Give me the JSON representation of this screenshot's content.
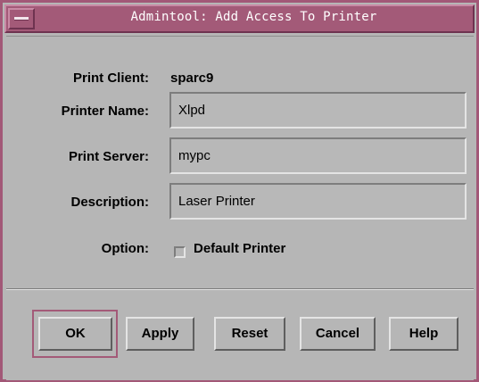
{
  "window": {
    "title": "Admintool: Add Access To Printer",
    "menu_icon": "window-menu-icon",
    "accent_color": "#a35a78",
    "background_color": "#b6b6b6"
  },
  "form": {
    "print_client": {
      "label": "Print Client:",
      "value": "sparc9"
    },
    "printer_name": {
      "label": "Printer Name:",
      "value": "Xlpd"
    },
    "print_server": {
      "label": "Print Server:",
      "value": "mypc"
    },
    "description": {
      "label": "Description:",
      "value": "Laser Printer"
    },
    "option": {
      "label": "Option:",
      "checkbox_label": "Default Printer",
      "checked": false
    }
  },
  "buttons": {
    "ok": "OK",
    "apply": "Apply",
    "reset": "Reset",
    "cancel": "Cancel",
    "help": "Help"
  }
}
